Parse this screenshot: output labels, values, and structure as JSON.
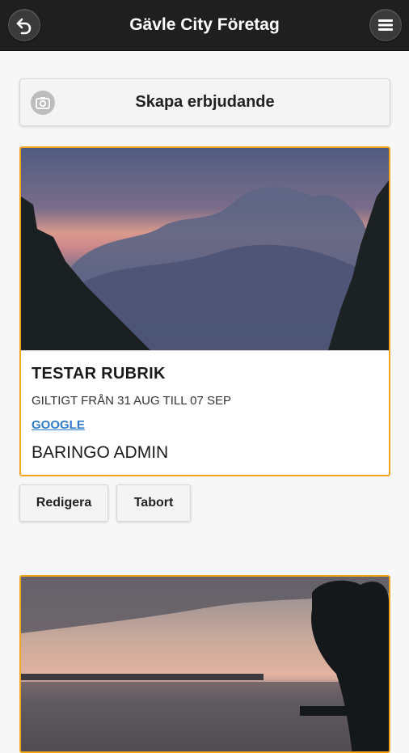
{
  "header": {
    "title": "Gävle City Företag",
    "back_icon": "back-arrow-icon",
    "menu_icon": "hamburger-menu-icon",
    "bar_color": "#1f1f1f"
  },
  "create_button": {
    "label": "Skapa erbjudande",
    "icon": "camera-icon"
  },
  "offers": [
    {
      "title": "TESTAR RUBRIK",
      "validity": "GILTIGT FRÅN 31 AUG TILL 07 SEP",
      "link": "GOOGLE",
      "author": "BARINGO ADMIN",
      "image": "sunset-clouds-photo",
      "actions": [
        "Redigera",
        "Tabort"
      ]
    },
    {
      "image": "lake-sunset-photo"
    }
  ],
  "accent_color": "#f2a41e",
  "link_color": "#2f7bc7"
}
